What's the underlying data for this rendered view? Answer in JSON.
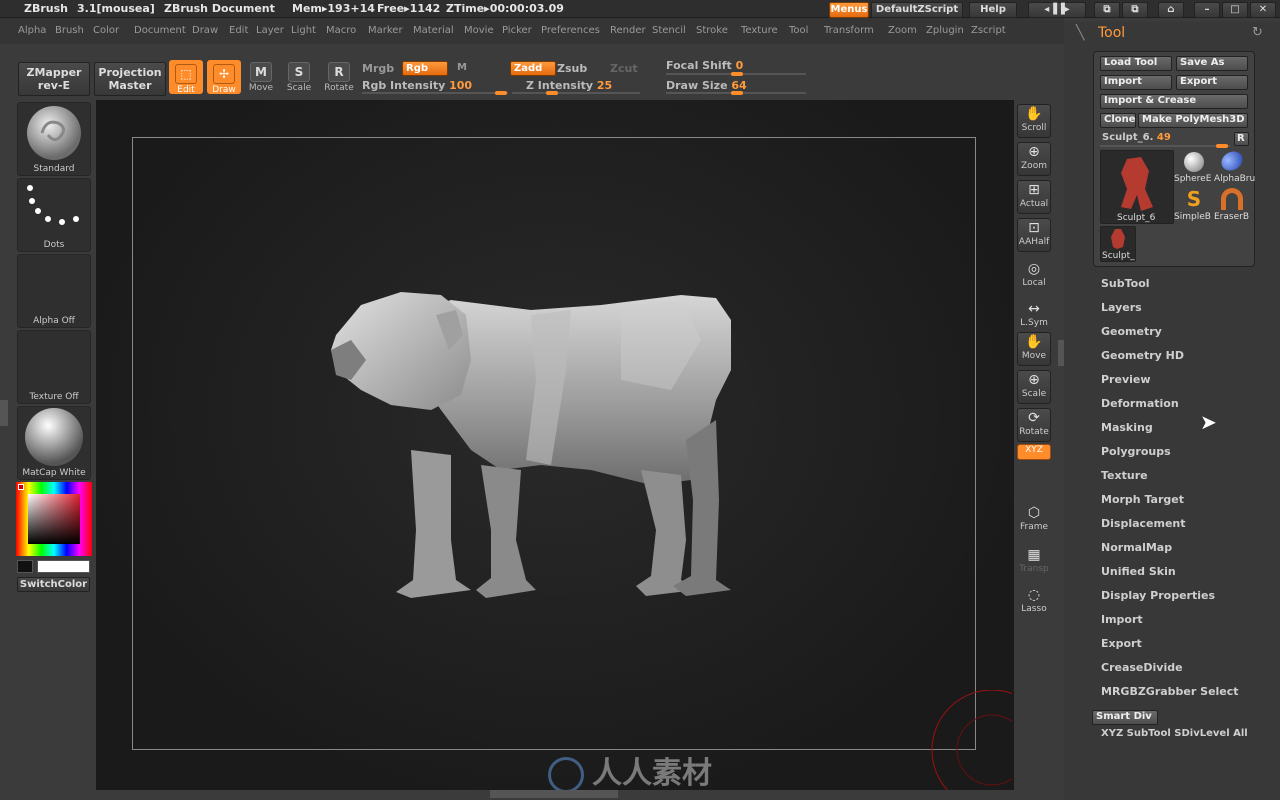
{
  "title_bar": {
    "app": "ZBrush",
    "version": "3.1[mousea]",
    "document": "ZBrush Document",
    "mem": "Mem▸193+14",
    "free": "Free▸1142",
    "ztime": "ZTime▸00:00:03.09",
    "menus_btn": "Menus",
    "script_btn": "DefaultZScript",
    "help_btn": "Help"
  },
  "menu_items": [
    "Alpha",
    "Brush",
    "Color",
    "Document",
    "Draw",
    "Edit",
    "Layer",
    "Light",
    "Macro",
    "Marker",
    "Material",
    "Movie",
    "Picker",
    "Preferences",
    "Render",
    "Stencil",
    "Stroke",
    "Texture",
    "Tool",
    "Transform",
    "Zoom",
    "Zplugin",
    "Zscript"
  ],
  "toolbar": {
    "zmapper": "ZMapper",
    "zmapper_sub": "rev-E",
    "projection": "Projection",
    "projection_sub": "Master",
    "edit": "Edit",
    "draw": "Draw",
    "move": "Move",
    "scale": "Scale",
    "rotate": "Rotate",
    "mrgb": "Mrgb",
    "rgb": "Rgb",
    "m": "M",
    "rgb_intensity_label": "Rgb Intensity",
    "rgb_intensity": "100",
    "zadd": "Zadd",
    "zsub": "Zsub",
    "zcut": "Zcut",
    "z_intensity_label": "Z Intensity",
    "z_intensity": "25",
    "focal_shift_label": "Focal Shift",
    "focal_shift": "0",
    "draw_size_label": "Draw Size",
    "draw_size": "64"
  },
  "left_shelf": {
    "brush": "Standard",
    "stroke": "Dots",
    "alpha": "Alpha  Off",
    "texture": "Texture  Off",
    "material": "MatCap  White",
    "switch_color": "SwitchColor"
  },
  "right_shelf": [
    "Scroll",
    "Zoom",
    "Actual",
    "AAHalf",
    "Local",
    "L.Sym",
    "Move",
    "Scale",
    "Rotate",
    "XYZ",
    "Frame",
    "Transp",
    "Lasso"
  ],
  "tool_panel": {
    "title": "Tool",
    "load_tool": "Load Tool",
    "save_as": "Save As",
    "import": "Import",
    "export": "Export",
    "import_crease": "Import & Crease",
    "clone": "Clone",
    "make_polymesh": "Make PolyMesh3D",
    "current_tool": "Sculpt_6.",
    "current_tool_value": "49",
    "r_btn": "R",
    "thumbs": [
      "Sculpt_6",
      "SphereE",
      "AlphaBru",
      "SimpleB",
      "EraserB",
      "Sculpt_"
    ],
    "sections": [
      "SubTool",
      "Layers",
      "Geometry",
      "Geometry HD",
      "Preview",
      "Deformation",
      "Masking",
      "Polygroups",
      "Texture",
      "Morph Target",
      "Displacement",
      "NormalMap",
      "Unified Skin",
      "Display Properties",
      "Import",
      "Export",
      "CreaseDivide",
      "MRGBZGrabber Select"
    ],
    "smart_div": "Smart Div",
    "xyz_subtool": "XYZ  SubTool  SDivLevel  All"
  },
  "watermark": "人人素材",
  "colors": {
    "accent": "#ff8c2a",
    "canvas": "#1f1f1f",
    "panel": "#383838"
  }
}
